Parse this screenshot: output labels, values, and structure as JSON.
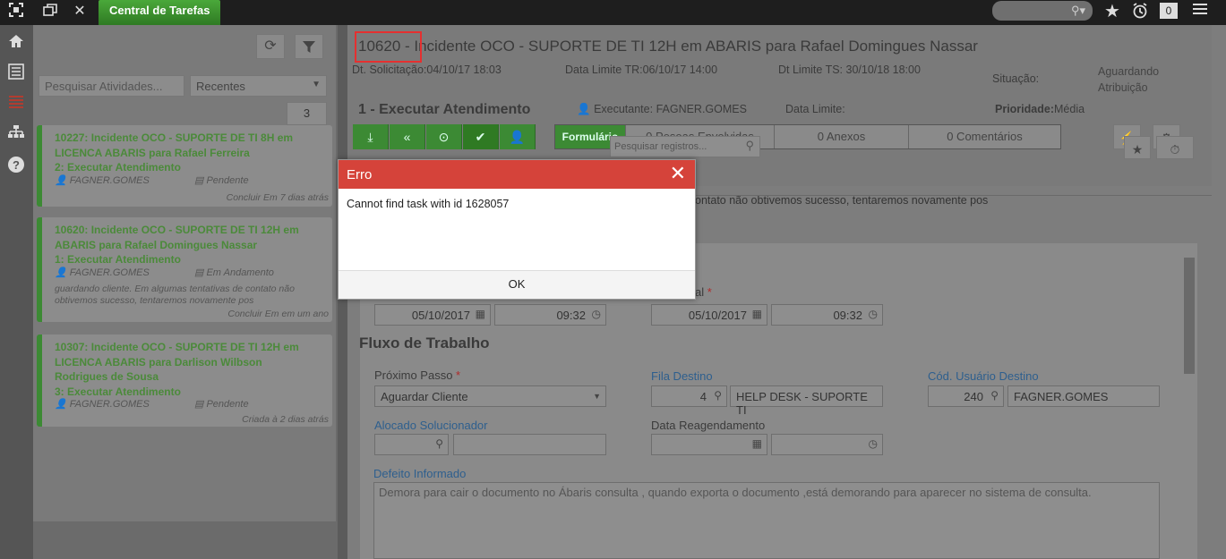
{
  "topbar": {
    "tab_label": "Central de Tarefas",
    "notif_count": "0",
    "icons": [
      "fullscreen-icon",
      "windows-icon",
      "close-icon",
      "search-icon",
      "star-icon",
      "alarm-icon",
      "menu-icon"
    ]
  },
  "rail": {
    "icons": [
      "home-icon",
      "list-icon",
      "tasks-icon",
      "org-chart-icon",
      "help-icon"
    ]
  },
  "task_panel": {
    "search_placeholder": "Pesquisar Atividades...",
    "filter_value": "Recentes",
    "count": "3",
    "cards": [
      {
        "title": "10227: Incidente OCO - SUPORTE DE TI 8H em LICENCA ABARIS para Rafael Ferreira",
        "step": "2: Executar Atendimento",
        "user": "FAGNER.GOMES",
        "status": "Pendente",
        "desc": "",
        "footer": "Concluir Em 7 dias atrás"
      },
      {
        "title": "10620: Incidente OCO - SUPORTE DE TI 12H em ABARIS para Rafael Domingues Nassar",
        "step": "1: Executar Atendimento",
        "user": "FAGNER.GOMES",
        "status": "Em Andamento",
        "desc": "guardando cliente. Em algumas tentativas de contato não obtivemos sucesso, tentaremos novamente pos",
        "footer": "Concluir Em em um ano"
      },
      {
        "title": "10307: Incidente OCO - SUPORTE DE TI 12H em LICENCA ABARIS para Darlison Wilbson Rodrigues de Sousa",
        "step": "3: Executar Atendimento",
        "user": "FAGNER.GOMES",
        "status": "Pendente",
        "desc": "",
        "footer": "Criada à 2 dias atrás"
      }
    ]
  },
  "header": {
    "title": "10620 - Incidente OCO - SUPORTE DE TI 12H em ABARIS para Rafael Domingues Nassar",
    "dt_solicitacao_label": "Dt. Solicitação:",
    "dt_solicitacao": "04/10/17 18:03",
    "data_limite_tr_label": "Data Limite TR:",
    "data_limite_tr": "06/10/17 14:00",
    "dt_limite_ts_label": "Dt Limite TS:",
    "dt_limite_ts": "30/10/18 18:00",
    "situacao_label": "Situação:",
    "situacao_line1": "Aguardando",
    "situacao_line2": "Atribuição",
    "step_title": "1 - Executar Atendimento",
    "executante_label": "Executante:",
    "executante": "FAGNER.GOMES",
    "data_limite_label": "Data Limite:",
    "prioridade_label": "Prioridade:",
    "prioridade": "Média",
    "form_tab": "Formulário",
    "pessoas": "0 Pesoas Envolvidas",
    "anexos": "0 Anexos",
    "comentarios": "0 Comentários",
    "search_placeholder": "Pesquisar registros...",
    "bg_text": "ontato não obtivemos sucesso, tentaremos novamente pos"
  },
  "form": {
    "date1": "05/10/2017",
    "time1": "09:32",
    "label_al": "al",
    "date2": "05/10/2017",
    "time2": "09:32",
    "section_title": "Fluxo de Trabalho",
    "proximo_passo_label": "Próximo Passo",
    "proximo_passo": "Aguardar Cliente",
    "fila_destino_label": "Fila Destino",
    "fila_code": "4",
    "fila_name": "HELP DESK - SUPORTE TI",
    "cod_usuario_label": "Cód. Usuário Destino",
    "cod_usuario": "240",
    "usuario_name": "FAGNER.GOMES",
    "alocado_label": "Alocado Solucionador",
    "data_reag_label": "Data Reagendamento",
    "defeito_label": "Defeito Informado",
    "defeito": "Demora para  cair o documento no Ábaris consulta , quando exporta o documento ,está demorando para aparecer no sistema de consulta."
  },
  "modal": {
    "title": "Erro",
    "message": "Cannot find task with id 1628057",
    "ok_label": "OK",
    "header_color": "#d5433a"
  }
}
